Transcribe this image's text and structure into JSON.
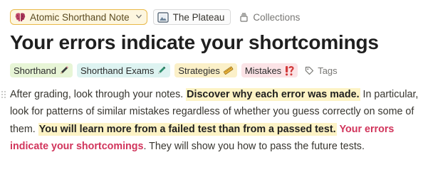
{
  "breadcrumb": {
    "note_type": "Atomic Shorthand Note",
    "note_type_icon": "brain-emoji-icon",
    "parent": "The Plateau",
    "parent_icon": "image-frame-icon",
    "collections": "Collections",
    "collections_icon": "collection-stack-icon"
  },
  "page": {
    "title": "Your errors indicate your shortcomings"
  },
  "tags": [
    {
      "label": "Shorthand",
      "icon": "pencil-icon",
      "color": "#e7f5d6"
    },
    {
      "label": "Shorthand Exams",
      "icon": "pen-icon",
      "color": "#ddf3f1"
    },
    {
      "label": "Strategies",
      "icon": "ruler-icon",
      "color": "#fbf0c8"
    },
    {
      "label": "Mistakes",
      "icon": "exclamation-question-icon",
      "color": "#fbe3e6"
    }
  ],
  "tags_button": "Tags",
  "body": {
    "seg1": "After grading, look through your notes. ",
    "seg2": "Discover why each error was made.",
    "seg3": " In particular, look for patterns of similar mistakes regardless of whether you guess correctly on some of them. ",
    "seg4": "You will learn more from a failed test than from a passed test.",
    "seg5": " ",
    "seg6": "Your errors indicate your shortcomings",
    "seg7": ". They will show you how to pass the future tests."
  },
  "colors": {
    "highlight": "#fdf3c5",
    "accent_red": "#d1345b",
    "selector_border": "#e9b949"
  }
}
